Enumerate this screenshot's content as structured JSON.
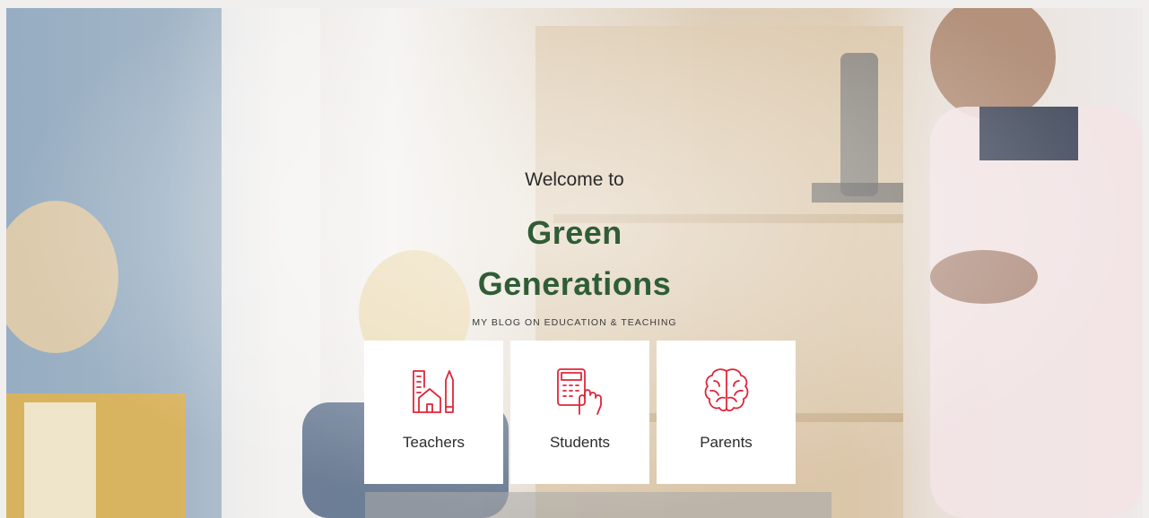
{
  "hero": {
    "welcome": "Welcome to",
    "title_line1": "Green",
    "title_line2": "Generations",
    "tagline": "MY BLOG ON EDUCATION & TEACHING"
  },
  "cards": [
    {
      "label": "Teachers",
      "icon": "school-building-icon"
    },
    {
      "label": "Students",
      "icon": "calculator-hand-icon"
    },
    {
      "label": "Parents",
      "icon": "brain-icon"
    }
  ],
  "colors": {
    "title": "#2f5d36",
    "icon_accent": "#e0263a",
    "card_bg": "#ffffff"
  }
}
